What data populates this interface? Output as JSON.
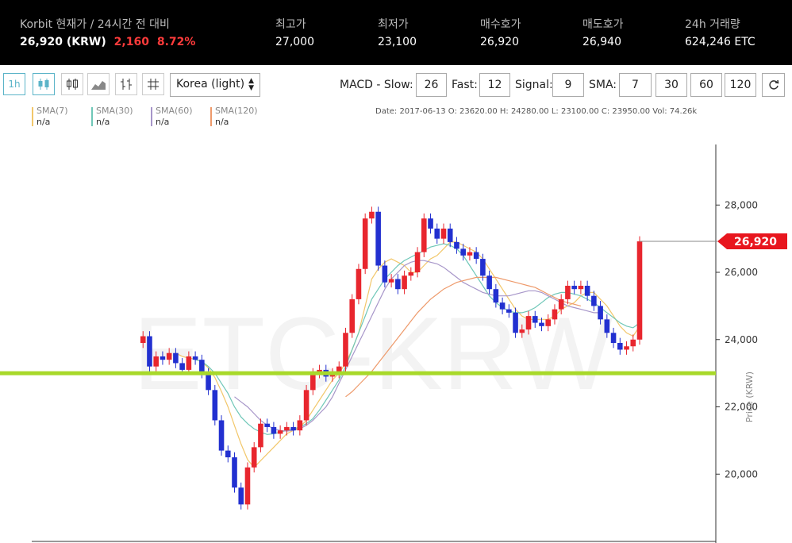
{
  "ticker": {
    "title": "Korbit 현재가 / 24시간 전 대비",
    "price": "26,920 (KRW)",
    "change": "2,160",
    "change_pct": "8.72%",
    "high_label": "최고가",
    "high": "27,000",
    "low_label": "최저가",
    "low": "23,100",
    "bid_label": "매수호가",
    "bid": "26,920",
    "ask_label": "매도호가",
    "ask": "26,940",
    "vol_label": "24h 거래량",
    "vol": "624,246 ETC",
    "up_color": "#ff3b3b"
  },
  "toolbar": {
    "interval": "1h",
    "theme_select": "Korea (light)",
    "macd_label": "MACD - Slow:",
    "slow": "26",
    "fast_label": "Fast:",
    "fast": "12",
    "signal_label": "Signal:",
    "signal": "9",
    "sma_label": "SMA:",
    "sma_values": [
      "7",
      "30",
      "60",
      "120"
    ]
  },
  "legend": [
    {
      "name": "SMA(7)",
      "value": "n/a",
      "color": "#f2c76a"
    },
    {
      "name": "SMA(30)",
      "value": "n/a",
      "color": "#6fc7b8"
    },
    {
      "name": "SMA(60)",
      "value": "n/a",
      "color": "#a796c9"
    },
    {
      "name": "SMA(120)",
      "value": "n/a",
      "color": "#ee9a6b"
    }
  ],
  "ohlc": "Date: 2017-06-13 O: 23620.00 H: 24280.00 L: 23100.00 C: 23950.00 Vol: 74.26k",
  "chart_data": {
    "type": "line",
    "title": "ETC-KRW",
    "ylabel": "Price (KRW)",
    "ylim": [
      18000,
      29800
    ],
    "y_ticks": [
      20000,
      22000,
      24000,
      26000,
      28000
    ],
    "y_tick_labels": [
      "20,000",
      "22,000",
      "24,000",
      "26,000",
      "28,000"
    ],
    "current_price": 26920,
    "current_price_label": "26,920",
    "support_level": 23000,
    "up_color": "#e8262e",
    "down_color": "#2230d0",
    "support_color": "#a8d92a",
    "series": [
      {
        "name": "Price",
        "values": [
          23900,
          24100,
          23200,
          23500,
          23400,
          23600,
          23300,
          23100,
          23500,
          23400,
          23000,
          22500,
          21600,
          20700,
          20500,
          19600,
          19100,
          20200,
          20800,
          21500,
          21400,
          21200,
          21300,
          21400,
          21300,
          21600,
          22500,
          23000,
          23100,
          22900,
          23000,
          23200,
          24200,
          25200,
          26100,
          27600,
          27800,
          26200,
          25700,
          25800,
          25500,
          25900,
          26000,
          26600,
          27600,
          27300,
          27000,
          27300,
          26900,
          26700,
          26500,
          26600,
          26400,
          25900,
          25500,
          25100,
          24900,
          24800,
          24200,
          24300,
          24700,
          24500,
          24400,
          24600,
          24900,
          25200,
          25600,
          25500,
          25600,
          25300,
          25000,
          24600,
          24200,
          23900,
          23700,
          23800,
          24000,
          26920
        ]
      },
      {
        "name": "SMA(7)",
        "values": [
          null,
          null,
          null,
          null,
          null,
          null,
          23600,
          23500,
          23450,
          23420,
          23330,
          23160,
          22870,
          22460,
          22000,
          21440,
          20900,
          20430,
          20200,
          20400,
          20600,
          20800,
          21000,
          21200,
          21300,
          21400,
          21600,
          21900,
          22200,
          22500,
          22800,
          23000,
          23300,
          23700,
          24200,
          25000,
          25800,
          26100,
          26300,
          26400,
          26300,
          26200,
          26000,
          26000,
          26200,
          26400,
          26500,
          26700,
          26900,
          26900,
          26800,
          26700,
          26600,
          26400,
          26100,
          25800,
          25500,
          25200,
          24900,
          24700,
          24600,
          24600,
          24600,
          24600,
          24700,
          24900,
          25000,
          25100,
          25300,
          25400,
          25400,
          25200,
          25000,
          24700,
          24400,
          24200,
          24100,
          24400
        ]
      },
      {
        "name": "SMA(30)",
        "values": [
          null,
          null,
          null,
          null,
          null,
          null,
          null,
          null,
          null,
          23400,
          23350,
          23200,
          23000,
          22700,
          22400,
          22000,
          21700,
          21500,
          21350,
          21250,
          21180,
          21200,
          21250,
          21300,
          21350,
          21400,
          21500,
          21650,
          21900,
          22200,
          22500,
          22800,
          23200,
          23700,
          24200,
          24700,
          25200,
          25500,
          25800,
          26000,
          26200,
          26350,
          26450,
          26550,
          26650,
          26750,
          26800,
          26850,
          26800,
          26700,
          26500,
          26200,
          25900,
          25600,
          25300,
          25100,
          24950,
          24850,
          24800,
          24800,
          24850,
          24950,
          25100,
          25250,
          25350,
          25400,
          25400,
          25350,
          25300,
          25200,
          25100,
          24950,
          24800,
          24650,
          24500,
          24400,
          24350,
          24500
        ]
      },
      {
        "name": "SMA(60)",
        "values": [
          null,
          null,
          null,
          null,
          null,
          null,
          null,
          null,
          null,
          null,
          null,
          null,
          null,
          null,
          null,
          22300,
          22150,
          22000,
          21800,
          21600,
          21450,
          21350,
          21300,
          21280,
          21300,
          21350,
          21450,
          21600,
          21800,
          22000,
          22300,
          22700,
          23100,
          23500,
          23900,
          24300,
          24700,
          25100,
          25500,
          25800,
          26000,
          26200,
          26300,
          26350,
          26350,
          26300,
          26250,
          26150,
          26000,
          25850,
          25700,
          25600,
          25500,
          25400,
          25350,
          25300,
          25300,
          25300,
          25350,
          25400,
          25450,
          25450,
          25400,
          25300,
          25200,
          25100,
          25000,
          24950,
          24900,
          24850,
          24800,
          24800
        ]
      },
      {
        "name": "SMA(120)",
        "values": [
          null,
          null,
          null,
          null,
          null,
          null,
          null,
          null,
          null,
          null,
          null,
          null,
          null,
          null,
          null,
          null,
          null,
          null,
          null,
          null,
          null,
          null,
          null,
          null,
          null,
          null,
          null,
          null,
          null,
          null,
          null,
          null,
          22300,
          22450,
          22650,
          22850,
          23050,
          23300,
          23550,
          23800,
          24050,
          24300,
          24550,
          24800,
          25000,
          25200,
          25350,
          25500,
          25600,
          25700,
          25750,
          25800,
          25850,
          25850,
          25850,
          25850,
          25800,
          25750,
          25700,
          25650,
          25600,
          25550,
          25450,
          25350,
          25250,
          25150,
          25100,
          25050,
          25000
        ]
      }
    ]
  }
}
